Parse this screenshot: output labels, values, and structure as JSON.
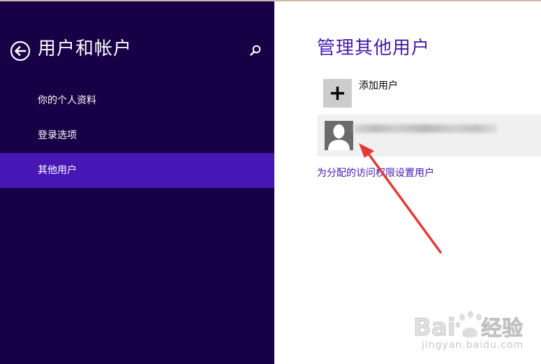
{
  "sidebar": {
    "title": "用户和帐户",
    "items": [
      {
        "label": "你的个人资料",
        "active": false
      },
      {
        "label": "登录选项",
        "active": false
      },
      {
        "label": "其他用户",
        "active": true
      }
    ]
  },
  "main": {
    "title": "管理其他用户",
    "add_user_label": "添加用户",
    "assigned_access_link": "为分配的访问权限设置用户"
  },
  "watermark": {
    "brand": "Baidu经验",
    "domain": "jingyan.baidu.com"
  },
  "colors": {
    "sidebar_bg": "#170046",
    "accent": "#4617b4",
    "annotation_arrow": "#e53935"
  },
  "icons": {
    "back": "back-arrow-icon",
    "search": "search-icon",
    "add": "plus-icon",
    "avatar": "user-silhouette-icon"
  }
}
